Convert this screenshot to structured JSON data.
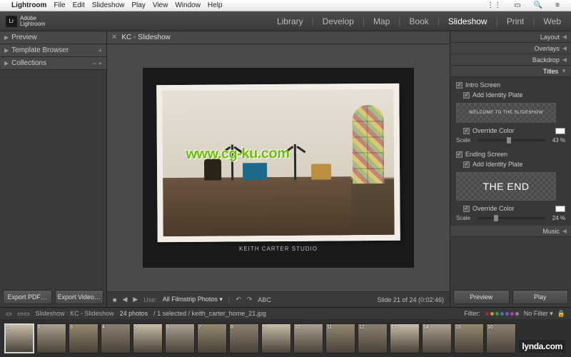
{
  "macmenu": {
    "app": "Lightroom",
    "items": [
      "File",
      "Edit",
      "Slideshow",
      "Play",
      "View",
      "Window",
      "Help"
    ]
  },
  "logo": {
    "mark": "Lr",
    "line1": "Adobe",
    "line2": "Lightroom"
  },
  "modules": [
    "Library",
    "Develop",
    "Map",
    "Book",
    "Slideshow",
    "Print",
    "Web"
  ],
  "active_module": "Slideshow",
  "left": {
    "panels": [
      {
        "title": "Preview",
        "ops": ""
      },
      {
        "title": "Template Browser",
        "ops": "+"
      },
      {
        "title": "Collections",
        "ops": "− +"
      }
    ],
    "export_pdf": "Export PDF…",
    "export_video": "Export Video…"
  },
  "tab": {
    "title": "KC - Slideshow"
  },
  "slide": {
    "caption": "KEITH CARTER STUDIO",
    "watermark": "www.cg-ku.com"
  },
  "toolbar": {
    "use_label": "Use:",
    "use_value": "All Filmstrip Photos",
    "abc": "ABC",
    "status": "Slide 21 of 24 (0:02:46)"
  },
  "right": {
    "panels_collapsed": [
      "Layout",
      "Overlays",
      "Backdrop"
    ],
    "titles": {
      "label": "Titles",
      "intro_screen": "Intro Screen",
      "add_identity_plate": "Add Identity Plate",
      "plate_intro": "WELCOME TO THE SLIDESHOW",
      "override_color": "Override Color",
      "scale_label": "Scale",
      "scale_intro": "43 %",
      "ending_screen": "Ending Screen",
      "plate_ending": "THE END",
      "scale_ending": "24 %"
    },
    "music": "Music",
    "preview": "Preview",
    "play": "Play"
  },
  "filterbar": {
    "crumb1": "Slideshow",
    "crumb2": "KC - Slideshow",
    "count": "24 photos",
    "selected": "/ 1 selected / keith_carter_home_21.jpg",
    "filter_label": "Filter:",
    "no_filter": "No Filter"
  },
  "dot_colors": [
    "#9c3030",
    "#c99830",
    "#389c44",
    "#3878c0",
    "#8850c0",
    "#b040a0",
    "#888888"
  ],
  "thumbs": [
    1,
    2,
    3,
    4,
    5,
    6,
    7,
    8,
    9,
    10,
    11,
    12,
    13,
    14,
    15,
    16
  ],
  "selected_thumb_index": 0,
  "lynda": "lynda.com"
}
